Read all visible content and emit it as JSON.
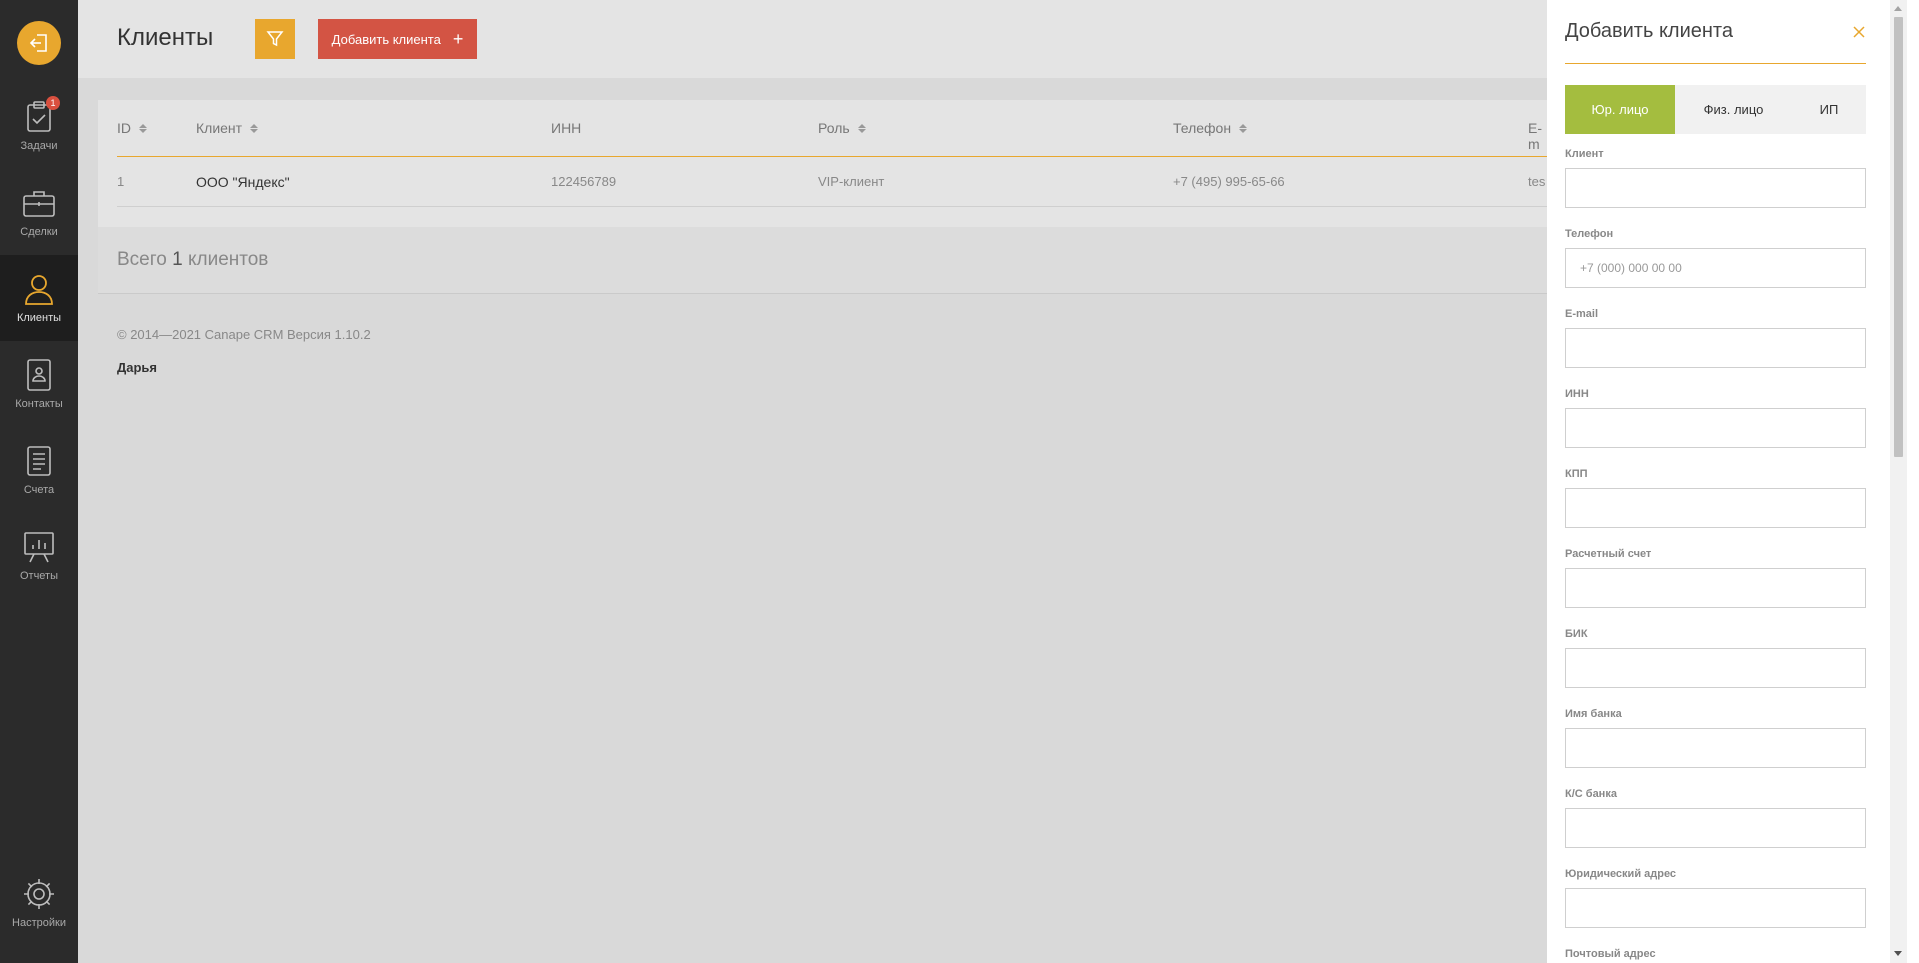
{
  "sidebar": {
    "items": [
      {
        "label": "Задачи",
        "icon": "clipboard-check-icon",
        "badge": "1"
      },
      {
        "label": "Сделки",
        "icon": "briefcase-icon"
      },
      {
        "label": "Клиенты",
        "icon": "user-icon",
        "active": true
      },
      {
        "label": "Контакты",
        "icon": "address-book-icon"
      },
      {
        "label": "Счета",
        "icon": "document-icon"
      },
      {
        "label": "Отчеты",
        "icon": "presentation-chart-icon"
      }
    ],
    "settings_label": "Настройки"
  },
  "header": {
    "title": "Клиенты",
    "add_button_label": "Добавить клиента",
    "add_button_plus": "+"
  },
  "table": {
    "columns": [
      "ID",
      "Клиент",
      "ИНН",
      "Роль",
      "Телефон",
      "E-m"
    ],
    "rows": [
      {
        "id": "1",
        "client": "ООО \"Яндекс\"",
        "inn": "122456789",
        "role": "VIP-клиент",
        "phone": "+7 (495) 995-65-66",
        "email": "tes"
      }
    ]
  },
  "summary": {
    "prefix": "Всего",
    "count": "1",
    "suffix": "клиентов"
  },
  "footer": {
    "copyright": "© 2014—2021 Canape CRM Версия 1.10.2",
    "user": "Дарья"
  },
  "panel": {
    "title": "Добавить клиента",
    "tabs": [
      "Юр. лицо",
      "Физ. лицо",
      "ИП"
    ],
    "active_tab": "Юр. лицо",
    "fields": [
      {
        "label": "Клиент",
        "placeholder": ""
      },
      {
        "label": "Телефон",
        "placeholder": "+7 (000) 000 00 00"
      },
      {
        "label": "E-mail",
        "placeholder": ""
      },
      {
        "label": "ИНН",
        "placeholder": ""
      },
      {
        "label": "КПП",
        "placeholder": ""
      },
      {
        "label": "Расчетный счет",
        "placeholder": ""
      },
      {
        "label": "БИК",
        "placeholder": ""
      },
      {
        "label": "Имя банка",
        "placeholder": ""
      },
      {
        "label": "К/С банка",
        "placeholder": ""
      },
      {
        "label": "Юридический адрес",
        "placeholder": ""
      },
      {
        "label": "Почтовый адрес",
        "placeholder": ""
      }
    ]
  },
  "colors": {
    "accent": "#e8a72e",
    "add_button": "#d35444",
    "active_tab": "#a4bd3f",
    "sidebar": "#2b2b2b"
  }
}
